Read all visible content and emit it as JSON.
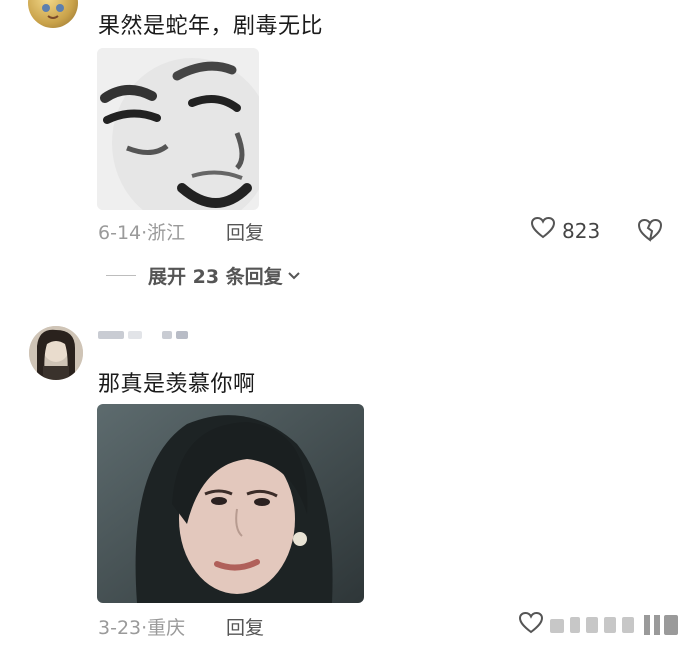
{
  "comments": [
    {
      "text": "果然是蛇年，剧毒无比",
      "date": "6-14",
      "location": "浙江",
      "reply_label": "回复",
      "likes": "823",
      "expand_label": "展开 23 条回复"
    },
    {
      "text": "那真是羡慕你啊",
      "date": "3-23",
      "location": "重庆",
      "reply_label": "回复"
    }
  ],
  "separator": "·",
  "colors": {
    "meta": "#9a9a9a",
    "text": "#1b1b1b",
    "icon": "#555555"
  },
  "icons": [
    "heart-outline-icon",
    "broken-heart-icon",
    "chevron-down-icon"
  ]
}
